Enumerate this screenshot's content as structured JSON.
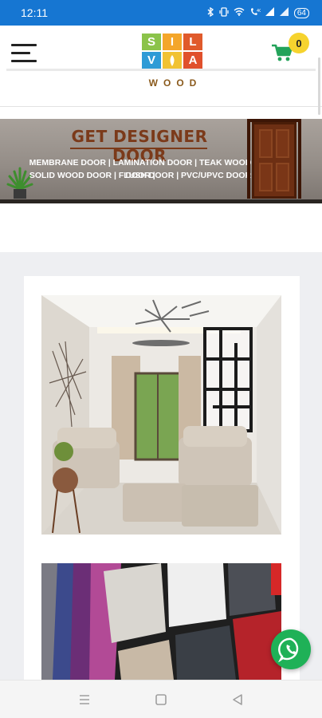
{
  "status_bar": {
    "time": "12:11",
    "battery": "64",
    "icons": [
      "bluetooth-icon",
      "vibrate-icon",
      "wifi-icon",
      "volte-icon",
      "signal-icon",
      "signal-icon",
      "battery-icon"
    ]
  },
  "header": {
    "menu_icon": "hamburger-menu-icon",
    "logo": {
      "tiles": [
        "S",
        "I",
        "L",
        "V",
        "",
        "A"
      ],
      "tile_colors": [
        "#8bc34a",
        "#f4a62a",
        "#e05a2b",
        "#2e9bd6",
        "#f1c232",
        "#e0502c"
      ],
      "word": "WOOD"
    },
    "cart_icon": "shopping-cart-icon",
    "cart_count": "0"
  },
  "banner": {
    "title": "GET DESIGNER DOOR",
    "line1": "MEMBRANE DOOR | LAMINATION DOOR | TEAK WOOD DOOR |",
    "line2": "SOLID WOOD DOOR | FLUSH DOOR | PVC/UPVC DOOR"
  },
  "images": {
    "first": "living-room-interior-image",
    "second": "laminate-samples-image"
  },
  "whatsapp_icon": "whatsapp-icon",
  "nav": {
    "recents_icon": "recents-icon",
    "home_icon": "home-icon",
    "back_icon": "back-icon"
  },
  "colors": {
    "status_bar": "#1676d2",
    "banner_title": "#7b3a1a",
    "cart_badge": "#f6d32e",
    "whatsapp": "#1fb157",
    "section_bg": "#eeeff2"
  }
}
